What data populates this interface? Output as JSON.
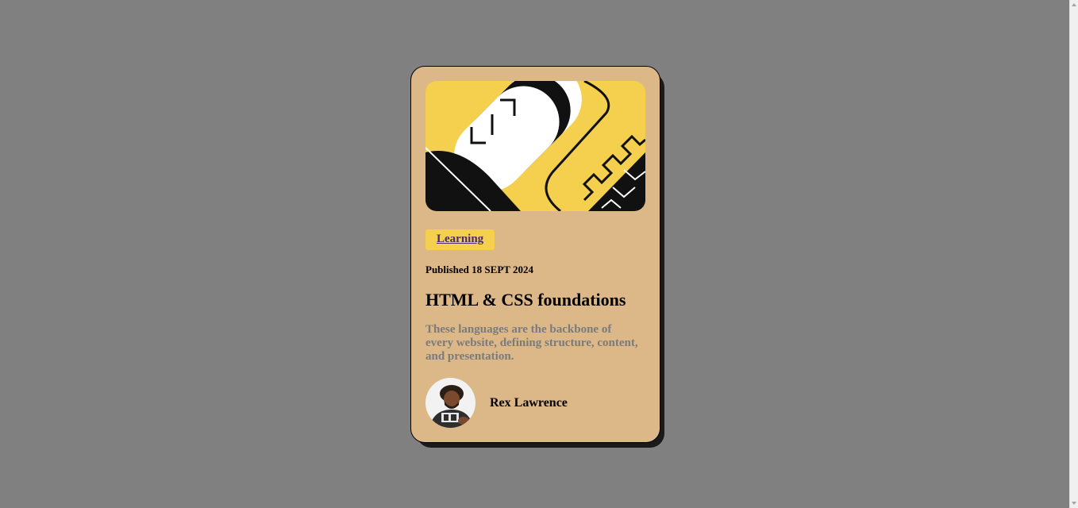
{
  "card": {
    "hero_image": "abstract-code-illustration",
    "tag_label": "Learning",
    "published": "Published 18 SEPT 2024",
    "title": "HTML & CSS foundations",
    "description": "These languages are the backbone of every website, defining structure, content, and presentation.",
    "author_name": "Rex Lawrence"
  },
  "colors": {
    "page_background": "#808080",
    "card_background": "#dcb788",
    "tag_background": "#f4d04e",
    "tag_text": "#4a2a6e",
    "description_text": "#7a7b7d",
    "shadow": "#1a1a1a"
  }
}
